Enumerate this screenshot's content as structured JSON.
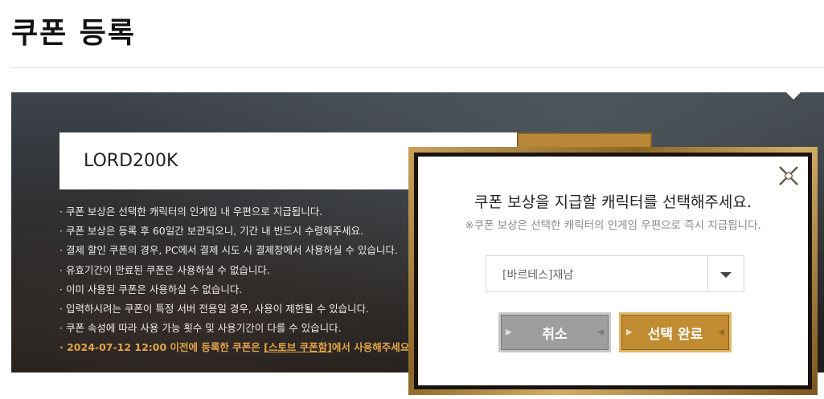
{
  "page": {
    "title": "쿠폰 등록"
  },
  "coupon": {
    "code_value": "LORD200K"
  },
  "notes": [
    "· 쿠폰 보상은 선택한 캐릭터의 인게임 내 우편으로 지급됩니다.",
    "· 쿠폰 보상은 등록 후 60일간 보관되오니, 기간 내 반드시 수령해주세요.",
    "· 결제 할인 쿠폰의 경우, PC에서 결제 시도 시 결제창에서 사용하실 수 있습니다.",
    "· 유효기간이 만료된 쿠폰은 사용하실 수 없습니다.",
    "· 이미 사용된 쿠폰은 사용하실 수 없습니다.",
    "· 입력하시려는 쿠폰이 특정 서버 전용일 경우, 사용이 제한될 수 있습니다.",
    "· 쿠폰 속성에 따라 사용 가능 횟수 및 사용기간이 다를 수 있습니다."
  ],
  "notice": {
    "prefix": "· 2024-07-12 12:00 이전에 등록한 쿠폰은 ",
    "link": "[스토브 쿠폰함]",
    "suffix": "에서 사용해주세요."
  },
  "modal": {
    "title": "쿠폰 보상을 지급할 캐릭터를 선택해주세요.",
    "subtitle": "※쿠폰 보상은 선택한 캐릭터의 인게임 우편으로 즉시 지급됩니다.",
    "selected_character": "[바르테스]재남",
    "cancel_label": "취소",
    "confirm_label": "선택 완료"
  },
  "colors": {
    "accent": "#c18c32",
    "notice": "#e3a44a",
    "cancel": "#9e9e9e"
  }
}
